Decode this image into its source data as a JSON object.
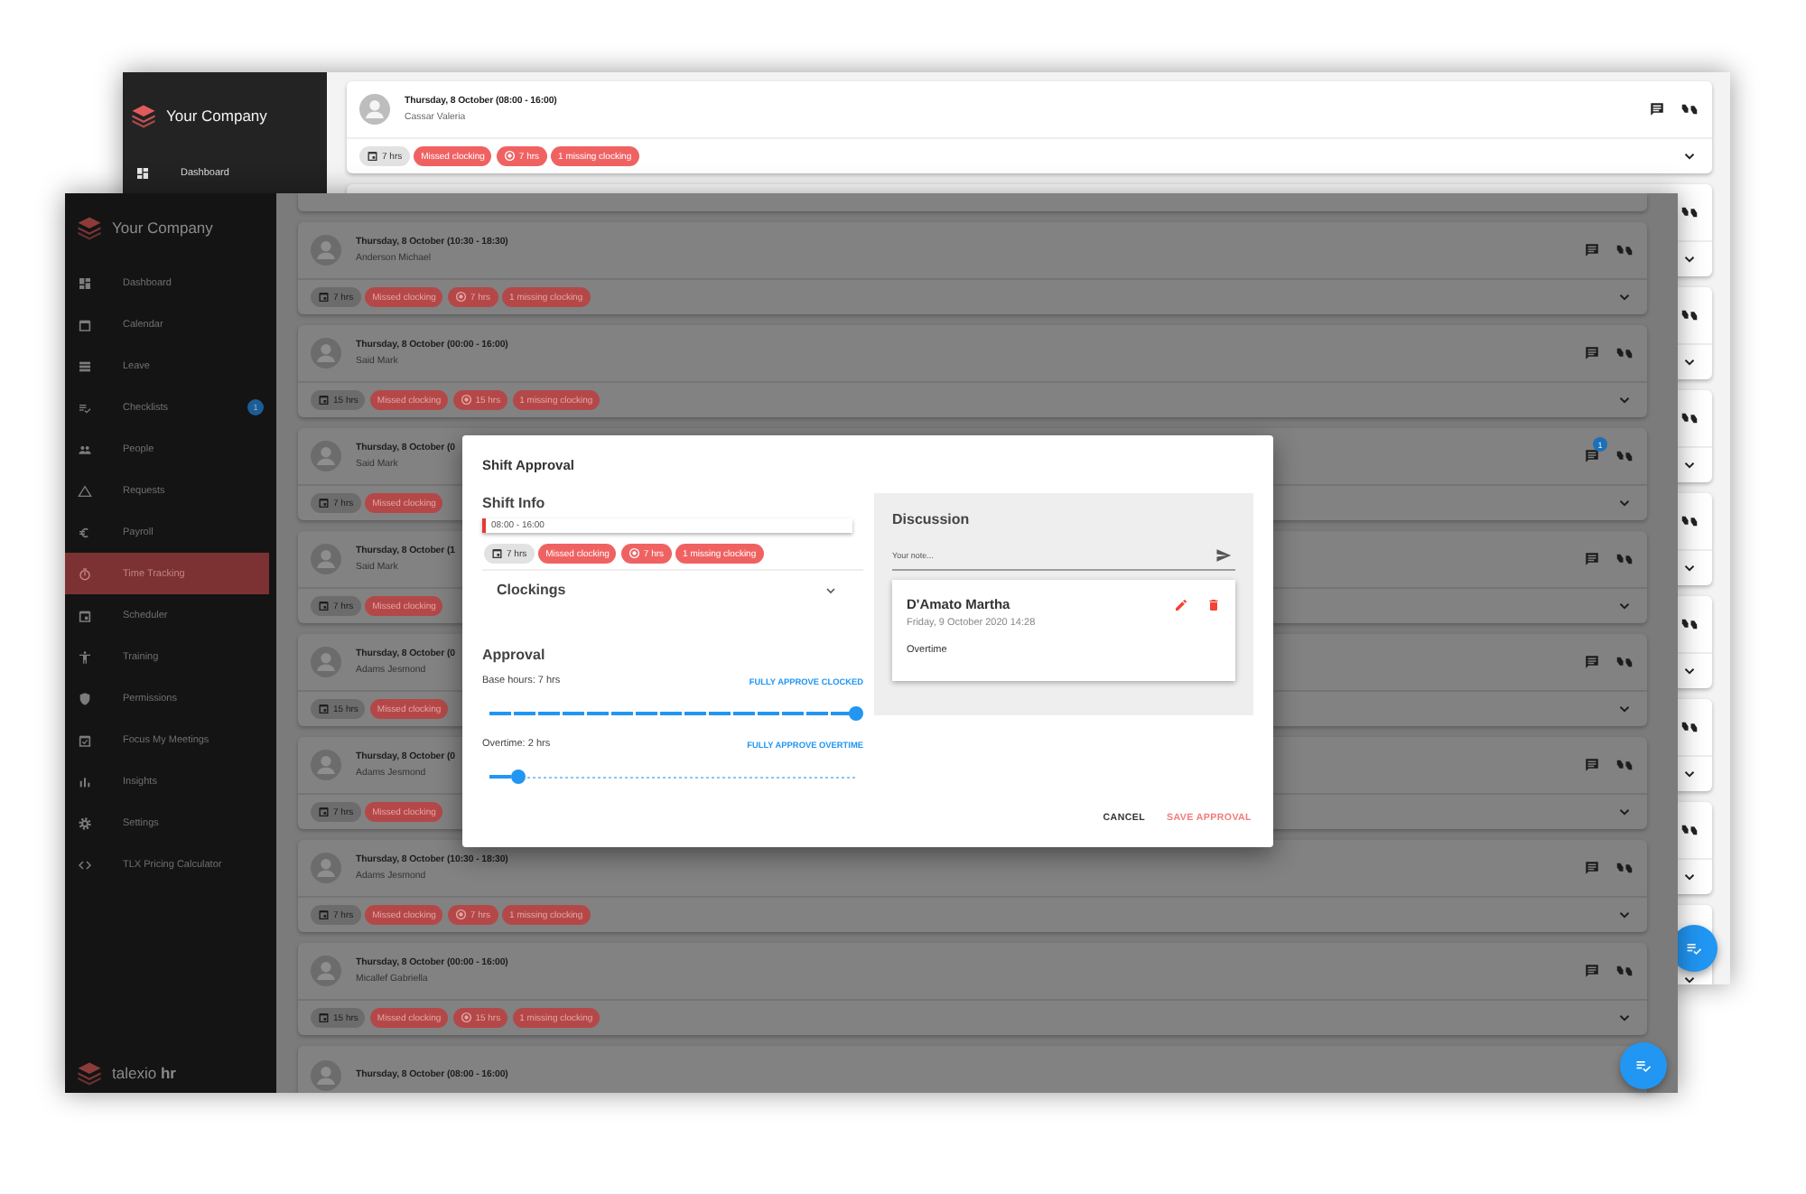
{
  "back_window": {
    "sidebar": {
      "company": "Your Company",
      "items": [
        {
          "label": "Dashboard"
        }
      ]
    },
    "shift": {
      "date": "Thursday, 8 October (08:00 - 16:00)",
      "name": "Cassar Valeria",
      "chips": [
        {
          "kind": "hours",
          "text": "7 hrs"
        },
        {
          "kind": "missed",
          "text": "Missed clocking"
        },
        {
          "kind": "overtime",
          "text": "7 hrs"
        },
        {
          "kind": "missing",
          "text": "1 missing clocking"
        }
      ]
    }
  },
  "front_window": {
    "sidebar": {
      "company": "Your Company",
      "items": [
        {
          "label": "Dashboard",
          "selected": false
        },
        {
          "label": "Calendar",
          "selected": false
        },
        {
          "label": "Leave",
          "selected": false
        },
        {
          "label": "Checklists",
          "selected": false,
          "badge": "1"
        },
        {
          "label": "People",
          "selected": false
        },
        {
          "label": "Requests",
          "selected": false
        },
        {
          "label": "Payroll",
          "selected": false
        },
        {
          "label": "Time Tracking",
          "selected": true
        },
        {
          "label": "Scheduler",
          "selected": false
        },
        {
          "label": "Training",
          "selected": false
        },
        {
          "label": "Permissions",
          "selected": false
        },
        {
          "label": "Focus My Meetings",
          "selected": false
        },
        {
          "label": "Insights",
          "selected": false
        },
        {
          "label": "Settings",
          "selected": false
        },
        {
          "label": "TLX Pricing Calculator",
          "selected": false
        }
      ],
      "brand": "talexio **hr**"
    },
    "shifts": [
      {
        "date": "Thursday, 8 October (10:30 - 18:30)",
        "name": "Anderson Michael",
        "chips": [
          {
            "kind": "hours",
            "text": "7 hrs"
          },
          {
            "kind": "missed",
            "text": "Missed clocking"
          },
          {
            "kind": "overtime",
            "text": "7 hrs"
          },
          {
            "kind": "missing",
            "text": "1 missing clocking"
          }
        ]
      },
      {
        "date": "Thursday, 8 October (00:00 - 16:00)",
        "name": "Said Mark",
        "chips": [
          {
            "kind": "hours",
            "text": "15 hrs"
          },
          {
            "kind": "missed",
            "text": "Missed clocking"
          },
          {
            "kind": "overtime",
            "text": "15 hrs"
          },
          {
            "kind": "missing",
            "text": "1 missing clocking"
          }
        ]
      },
      {
        "date": "Thursday, 8 October (0",
        "name": "Said Mark",
        "comment_badge": "1",
        "chips": [
          {
            "kind": "hours",
            "text": "7 hrs"
          },
          {
            "kind": "missed",
            "text": "Missed clocking"
          }
        ]
      },
      {
        "date": "Thursday, 8 October (1",
        "name": "Said Mark",
        "chips": [
          {
            "kind": "hours",
            "text": "7 hrs"
          },
          {
            "kind": "missed",
            "text": "Missed clocking"
          }
        ]
      },
      {
        "date": "Thursday, 8 October (0",
        "name": "Adams Jesmond",
        "chips": [
          {
            "kind": "hours",
            "text": "15 hrs"
          },
          {
            "kind": "missed",
            "text": "Missed clocking"
          }
        ]
      },
      {
        "date": "Thursday, 8 October (0",
        "name": "Adams Jesmond",
        "chips": [
          {
            "kind": "hours",
            "text": "7 hrs"
          },
          {
            "kind": "missed",
            "text": "Missed clocking"
          }
        ]
      },
      {
        "date": "Thursday, 8 October (10:30 - 18:30)",
        "name": "Adams Jesmond",
        "chips": [
          {
            "kind": "hours",
            "text": "7 hrs"
          },
          {
            "kind": "missed",
            "text": "Missed clocking"
          },
          {
            "kind": "overtime",
            "text": "7 hrs"
          },
          {
            "kind": "missing",
            "text": "1 missing clocking"
          }
        ]
      },
      {
        "date": "Thursday, 8 October (00:00 - 16:00)",
        "name": "Micallef Gabriella",
        "chips": [
          {
            "kind": "hours",
            "text": "15 hrs"
          },
          {
            "kind": "missed",
            "text": "Missed clocking"
          },
          {
            "kind": "overtime",
            "text": "15 hrs"
          },
          {
            "kind": "missing",
            "text": "1 missing clocking"
          }
        ]
      },
      {
        "date": "Thursday, 8 October (08:00 - 16:00)"
      }
    ]
  },
  "dialog": {
    "title": "Shift Approval",
    "shift_info": {
      "heading": "Shift Info",
      "time": "08:00 - 16:00",
      "chips": [
        {
          "kind": "hours",
          "text": "7 hrs"
        },
        {
          "kind": "missed",
          "text": "Missed clocking"
        },
        {
          "kind": "overtime",
          "text": "7 hrs"
        },
        {
          "kind": "missing",
          "text": "1 missing clocking"
        }
      ]
    },
    "clockings": {
      "label": "Clockings",
      "expanded": false
    },
    "approval": {
      "heading": "Approval",
      "base": {
        "label": "Base hours: 7 hrs",
        "action": "FULLY APPROVE CLOCKED",
        "level": 1
      },
      "overtime": {
        "label": "Overtime: 2 hrs",
        "action": "FULLY APPROVE OVERTIME",
        "level": 0.08
      }
    },
    "discussion": {
      "heading": "Discussion",
      "placeholder": "Your note...",
      "notes": [
        {
          "author": "D'Amato Martha",
          "date": "Friday, 9 October 2020 14:28",
          "text": "Overtime"
        }
      ]
    },
    "buttons": [
      {
        "kind": "cancel",
        "label": "CANCEL"
      },
      {
        "kind": "save",
        "label": "SAVE APPROVAL"
      }
    ]
  }
}
